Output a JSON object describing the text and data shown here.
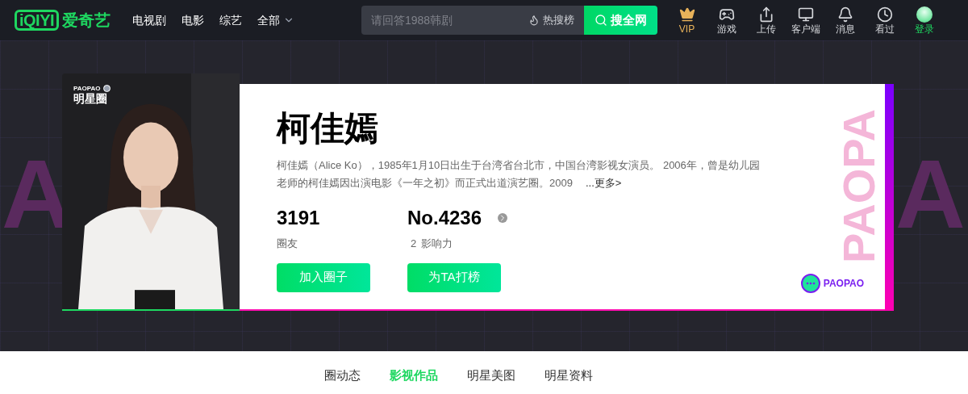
{
  "header": {
    "logo": {
      "mark": "iQIYI",
      "name": "爱奇艺"
    },
    "nav": [
      {
        "label": "电视剧",
        "dropdown": false
      },
      {
        "label": "电影",
        "dropdown": false
      },
      {
        "label": "综艺",
        "dropdown": false
      },
      {
        "label": "全部",
        "dropdown": true
      }
    ],
    "search": {
      "placeholder": "请回答1988韩剧",
      "hot": "热搜榜",
      "button": "搜全网"
    },
    "actions": [
      {
        "kind": "vip",
        "label": "VIP"
      },
      {
        "kind": "game",
        "label": "游戏"
      },
      {
        "kind": "upload",
        "label": "上传"
      },
      {
        "kind": "client",
        "label": "客户端"
      },
      {
        "kind": "message",
        "label": "消息"
      },
      {
        "kind": "history",
        "label": "看过"
      },
      {
        "kind": "login",
        "label": "登录"
      }
    ]
  },
  "banner": {
    "bg_letters": [
      "A",
      "A"
    ]
  },
  "profile": {
    "badge_brand": "PAOPAO",
    "badge_title": "明星圈",
    "name": "柯佳嫣",
    "bio": "柯佳嫣（Alice Ko），1985年1月10日出生于台湾省台北市，中国台湾影视女演员。 2006年，曾是幼儿园老师的柯佳嫣因出演电影《一年之初》而正式出道演艺圈。2009",
    "more": "...更多>",
    "stats": [
      {
        "value": "3191",
        "label": "圈友"
      },
      {
        "value": "No.4236",
        "prefix": "2",
        "label": "影响力"
      }
    ],
    "buttons": [
      "加入圈子",
      "为TA打榜"
    ],
    "brand": "PAOPAO",
    "watermark": "PAOPA"
  },
  "tabs": [
    {
      "label": "圈动态",
      "selected": false
    },
    {
      "label": "影视作品",
      "selected": true
    },
    {
      "label": "明星美图",
      "selected": false
    },
    {
      "label": "明星资料",
      "selected": false
    }
  ]
}
